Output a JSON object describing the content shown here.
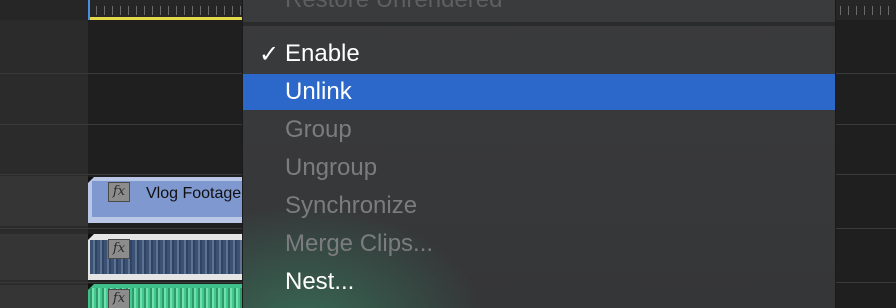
{
  "timeline": {
    "video_clip_title": "Vlog Footage",
    "fx_label": "fx",
    "colors": {
      "video_clip": "#7f98cf",
      "audio_clip_1": "#e5e5e5",
      "audio_clip_2": "#3fbf8a",
      "work_area_bar": "#e3d74a",
      "playhead": "#4a8fe0"
    }
  },
  "context_menu": {
    "highlight_color": "#2c68c9",
    "partial_item": {
      "label": "Restore Unrendered",
      "state": "disabled"
    },
    "items": [
      {
        "label": "Enable",
        "checked": true,
        "state": "enabled"
      },
      {
        "label": "Unlink",
        "state": "highlighted"
      },
      {
        "label": "Group",
        "state": "disabled"
      },
      {
        "label": "Ungroup",
        "state": "disabled"
      },
      {
        "label": "Synchronize",
        "state": "disabled"
      },
      {
        "label": "Merge Clips...",
        "state": "disabled"
      },
      {
        "label": "Nest...",
        "state": "enabled"
      }
    ],
    "check_icon": "checkmark-icon"
  }
}
